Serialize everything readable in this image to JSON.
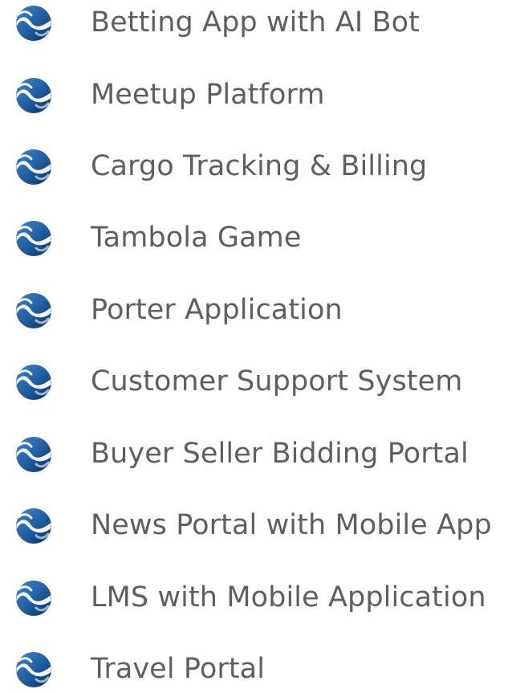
{
  "list": {
    "icon": "wave-logo-icon",
    "items": [
      {
        "label": "Betting App with AI Bot"
      },
      {
        "label": "Meetup Platform"
      },
      {
        "label": "Cargo Tracking & Billing"
      },
      {
        "label": "Tambola Game"
      },
      {
        "label": "Porter Application"
      },
      {
        "label": "Customer Support System"
      },
      {
        "label": "Buyer Seller Bidding Portal"
      },
      {
        "label": "News Portal with Mobile App"
      },
      {
        "label": "LMS with Mobile Application"
      },
      {
        "label": "Travel Portal"
      }
    ]
  },
  "colors": {
    "text": "#5f5f5f",
    "icon_dark": "#0b2c57",
    "icon_mid": "#1f5c9e",
    "icon_light": "#3f86c8"
  }
}
